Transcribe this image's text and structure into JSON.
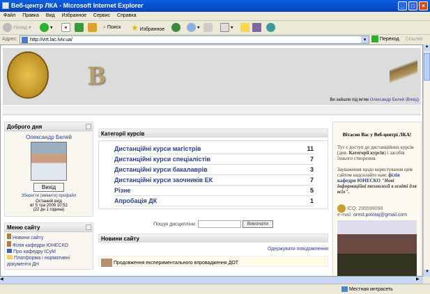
{
  "window": {
    "title": "Веб-центр ЛКА - Microsoft Internet Explorer"
  },
  "menu": [
    "Файл",
    "Правка",
    "Вид",
    "Избранное",
    "Сервис",
    "Справка"
  ],
  "toolbar": {
    "back": "Назад",
    "search": "Поиск",
    "favorites": "Избранное"
  },
  "address": {
    "label": "Адрес:",
    "url": "http://virt.lac.lviv.ua/",
    "go": "Переход",
    "links": "Ссылки"
  },
  "header": {
    "logo_letter": "В",
    "login_prefix": "Ви зайшли під ім'ям",
    "login_user": "Олександр Белей",
    "logout": "(Вихід)"
  },
  "left": {
    "greeting_title": "Доброго дня",
    "user_name": "Олександр Белей",
    "logout_button": "Вихід",
    "profile_link": "Зберегти (змінити) профайл",
    "last_login_label": "Останній вхід",
    "last_login_date": "вт 5 тра 2009 10:52",
    "last_login_ago": "(22 дн 1 година)",
    "menu_title": "Меню сайту",
    "menu_items": [
      "Новини сайту",
      "Філія кафедри ЮНЕСКО",
      "Про кафедру ІСуМ",
      "Платформа і нормативні документи ДН"
    ]
  },
  "center": {
    "categories_title": "Категорії курсів",
    "categories": [
      {
        "name": "Дистанційні курси магістрів",
        "count": "11"
      },
      {
        "name": "Дистанційні курси спеціалістів",
        "count": "7"
      },
      {
        "name": "Дистанційні курси бакалаврів",
        "count": "3"
      },
      {
        "name": "Дистанційні курси заочників ЕК",
        "count": "7"
      },
      {
        "name": "Різне",
        "count": "5"
      },
      {
        "name": "Апробація ДК",
        "count": "1"
      }
    ],
    "search_label": "Пошук дисципліни:",
    "search_value": "",
    "search_button": "Виконати",
    "news_title": "Новини сайту",
    "subscribe": "Одержувати повідомлення",
    "news_item": "Продовження експериментального впровадження ДОТ"
  },
  "right": {
    "welcome": "Вітаємо Вас у Веб-центрі ЛКА!",
    "p1a": "Тут є доступ до дистанційних курсів (див. ",
    "p1b": "Категорії курсів",
    "p1c": ") і засобів їхнього створення.",
    "p2a": "Зауваження щодо користування цим сайтом надсилайте нам: ",
    "p2b": "філія кафедри ЮНЕСКО",
    "p2c": " \"Нові інформаційні технології в освіті для всіх\".",
    "icq_label": "ICQ:",
    "icq": "295599098",
    "email_label": "e-mail:",
    "email": "orest.polotaj@gmail.com"
  },
  "status": {
    "zone": "Местная интрасеть"
  }
}
